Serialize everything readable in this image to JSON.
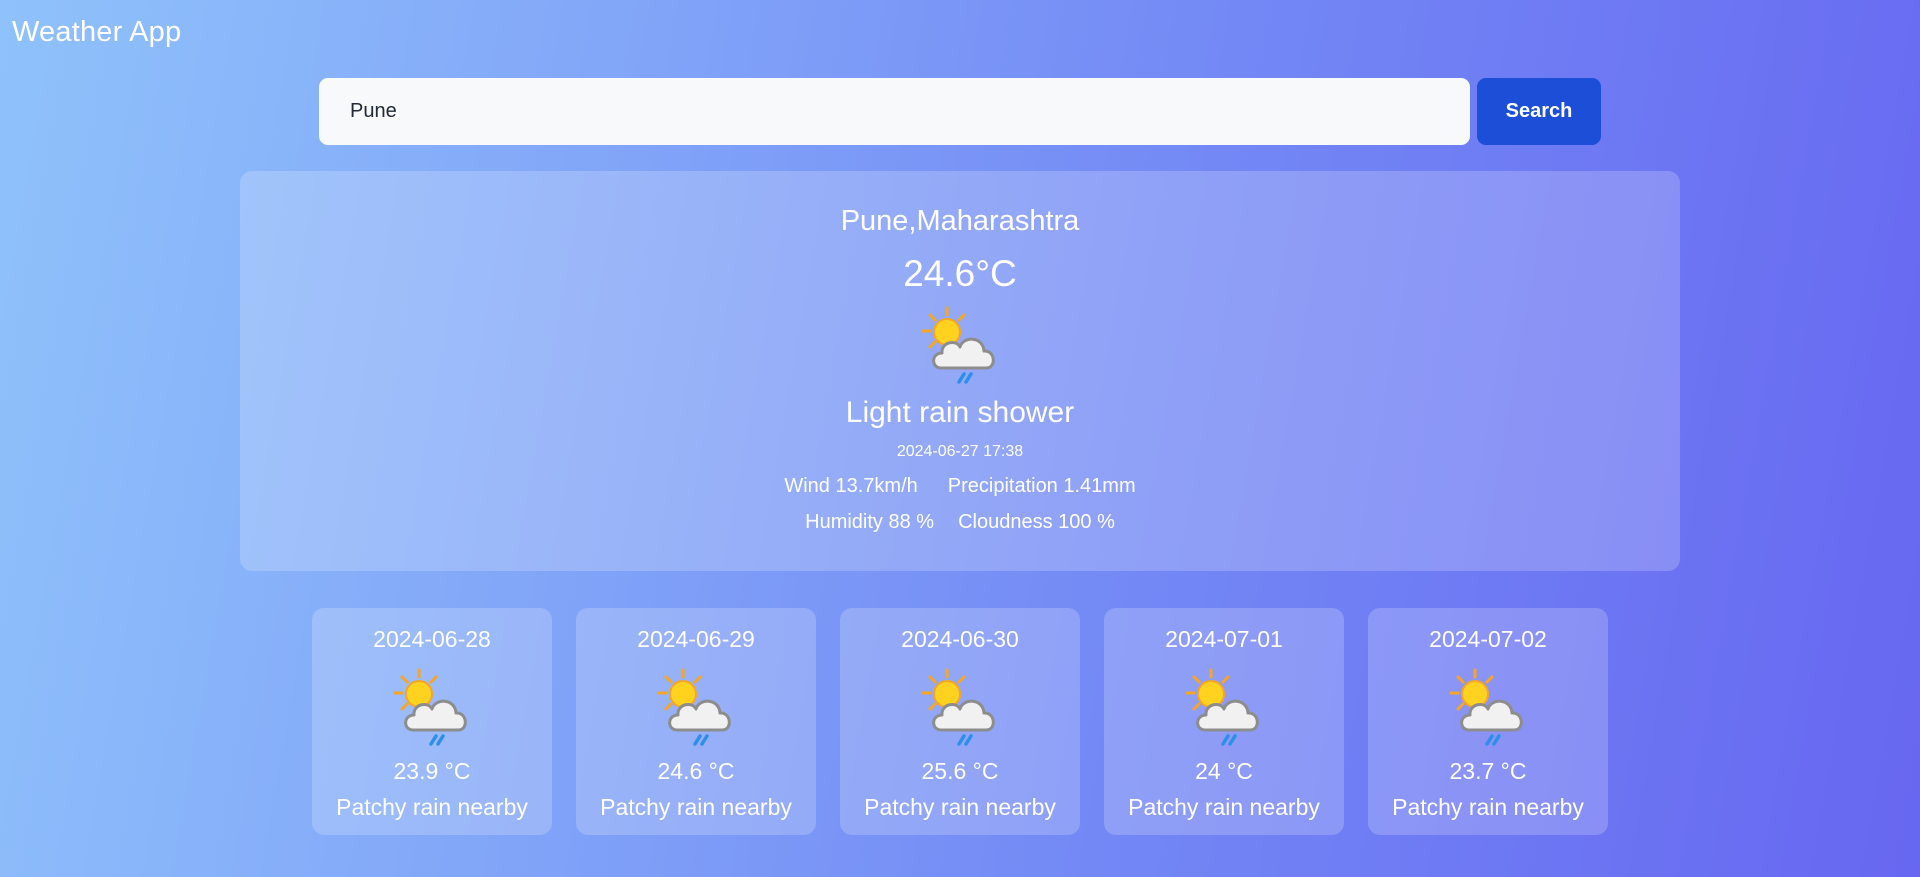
{
  "app": {
    "title": "Weather App"
  },
  "search": {
    "value": "Pune",
    "button_label": "Search"
  },
  "current": {
    "location": "Pune,Maharashtra",
    "temperature": "24.6°C",
    "icon": "sun-cloud-rain-icon",
    "condition": "Light rain shower",
    "datetime": "2024-06-27 17:38",
    "wind": "Wind 13.7km/h",
    "precipitation": "Precipitation 1.41mm",
    "humidity": "Humidity 88 %",
    "cloudness": "Cloudness 100 %"
  },
  "forecast": [
    {
      "date": "2024-06-28",
      "temp": "23.9 °C",
      "condition": "Patchy rain nearby",
      "icon": "sun-cloud-rain-icon"
    },
    {
      "date": "2024-06-29",
      "temp": "24.6 °C",
      "condition": "Patchy rain nearby",
      "icon": "sun-cloud-rain-icon"
    },
    {
      "date": "2024-06-30",
      "temp": "25.6 °C",
      "condition": "Patchy rain nearby",
      "icon": "sun-cloud-rain-icon"
    },
    {
      "date": "2024-07-01",
      "temp": "24 °C",
      "condition": "Patchy rain nearby",
      "icon": "sun-cloud-rain-icon"
    },
    {
      "date": "2024-07-02",
      "temp": "23.7 °C",
      "condition": "Patchy rain nearby",
      "icon": "sun-cloud-rain-icon"
    }
  ],
  "colors": {
    "button": "#1d4ed8",
    "input_background": "#f7f9fb",
    "gradient_start": "#8fc2fb",
    "gradient_end": "#6767f1"
  }
}
